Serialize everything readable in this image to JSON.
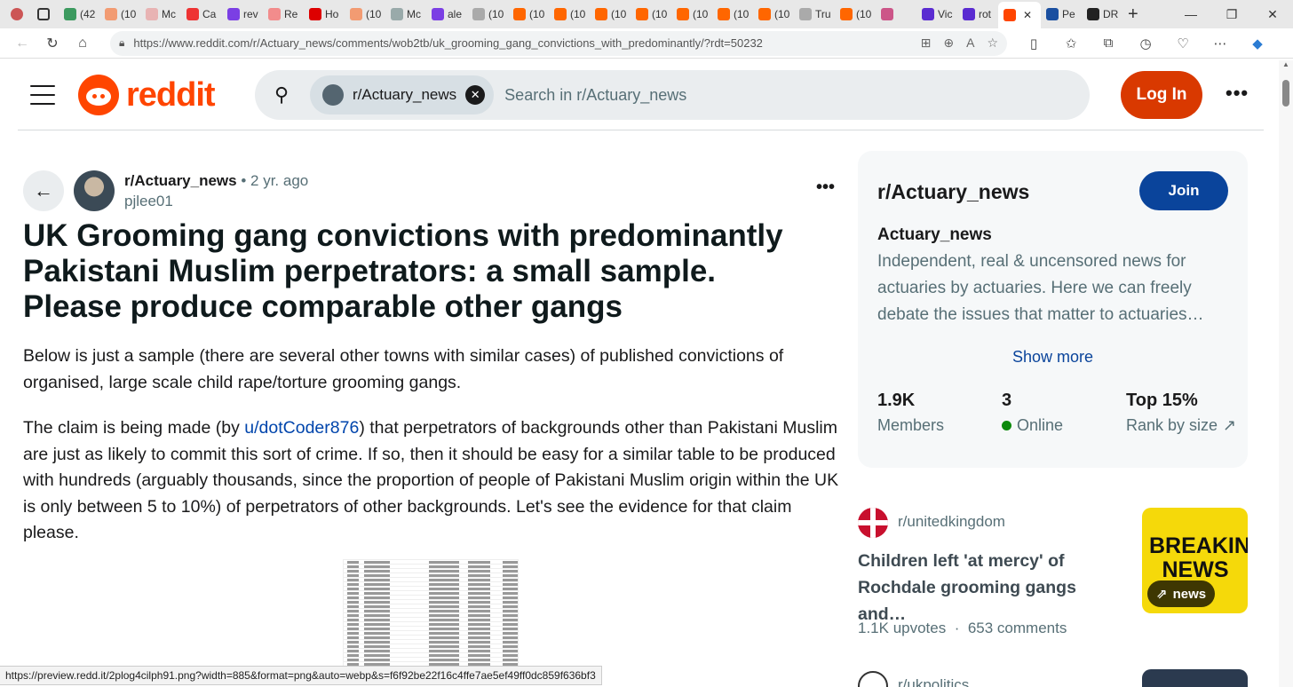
{
  "browser": {
    "tabs": [
      {
        "label": "(42",
        "color": "#3c9a5f"
      },
      {
        "label": "(10",
        "color": "#f29b72"
      },
      {
        "label": "Mc",
        "color": "#e8b3b3"
      },
      {
        "label": "Ca",
        "color": "#e33"
      },
      {
        "label": "rev",
        "color": "#7b3fe4"
      },
      {
        "label": "Re",
        "color": "#f28c8c"
      },
      {
        "label": "Ho",
        "color": "#d00"
      },
      {
        "label": "(10",
        "color": "#f29b72"
      },
      {
        "label": "Mc",
        "color": "#9aa"
      },
      {
        "label": "ale",
        "color": "#7b3fe4"
      },
      {
        "label": "(10",
        "color": "#aaa"
      },
      {
        "label": "(10",
        "color": "#f60"
      },
      {
        "label": "(10",
        "color": "#f60"
      },
      {
        "label": "(10",
        "color": "#f60"
      },
      {
        "label": "(10",
        "color": "#f60"
      },
      {
        "label": "(10",
        "color": "#f60"
      },
      {
        "label": "(10",
        "color": "#f60"
      },
      {
        "label": "(10",
        "color": "#f60"
      },
      {
        "label": "Tru",
        "color": "#aaa"
      },
      {
        "label": "(10",
        "color": "#f60"
      },
      {
        "label": "",
        "color": "#c58"
      },
      {
        "label": "Vic",
        "color": "#5a2bd1"
      },
      {
        "label": "rot",
        "color": "#5a2bd1"
      },
      {
        "label": "",
        "color": "#ff4500",
        "active": true
      },
      {
        "label": "Pe",
        "color": "#1a4fa0"
      },
      {
        "label": "DR",
        "color": "#222"
      }
    ],
    "active_tab_close": "✕",
    "new_tab": "+",
    "url": "https://www.reddit.com/r/Actuary_news/comments/wob2tb/uk_grooming_gang_convictions_with_predominantly/?rdt=50232"
  },
  "header": {
    "logo_text": "reddit",
    "search_chip": "r/Actuary_news",
    "search_placeholder": "Search in r/Actuary_news",
    "login_label": "Log In",
    "more": "•••"
  },
  "post": {
    "subreddit": "r/Actuary_news",
    "age": "• 2 yr. ago",
    "author": "pjlee01",
    "more": "•••",
    "title": "UK Grooming gang convictions with predominantly Pakistani Muslim perpetrators: a small sample. Please produce comparable other gangs",
    "para1": "Below is just a sample (there are several other towns with similar cases) of published convictions of organised, large scale child rape/torture grooming gangs.",
    "para2_pre": "The claim is being made (by ",
    "para2_link": "u/dotCoder876",
    "para2_post": ") that perpetrators of backgrounds other than Pakistani Muslim are just as likely to commit this sort of crime. If so, then it should be easy for a similar table to be produced with hundreds (arguably thousands, since the proportion of people of Pakistani Muslim origin within the UK is only between 5 to 10%) of perpetrators of other backgrounds. Let's see the evidence for that claim please."
  },
  "sidebar": {
    "name": "r/Actuary_news",
    "join_label": "Join",
    "desc_title": "Actuary_news",
    "description": "Independent, real & uncensored news for actuaries by actuaries. Here we can freely debate the issues that matter to actuaries…",
    "show_more": "Show more",
    "stats": [
      {
        "value": "1.9K",
        "label": "Members"
      },
      {
        "value": "3",
        "label": "Online"
      },
      {
        "value": "Top 15%",
        "label": "Rank by size"
      }
    ]
  },
  "related": {
    "subreddit": "r/unitedkingdom",
    "title": "Children left 'at mercy' of Rochdale grooming gangs and…",
    "thumb_text": "BREAKING NEWS",
    "thumb_badge": "news",
    "upvotes": "1.1K upvotes",
    "separator": "·",
    "comments": "653 comments",
    "next_subreddit": "r/ukpolitics"
  },
  "status_url": "https://preview.redd.it/2plog4cilph91.png?width=885&format=png&auto=webp&s=f6f92be22f16c4ffe7ae5ef49ff0dc859f636bf3",
  "colors": {
    "brand": "#ff4500",
    "login": "#d93900",
    "join": "#0a449b",
    "link": "#0045ac",
    "online": "#0c8a0c"
  }
}
